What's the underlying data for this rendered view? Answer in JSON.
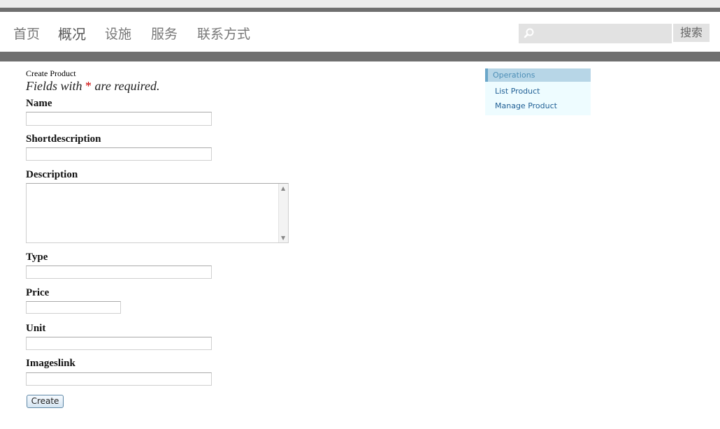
{
  "nav": {
    "items": [
      {
        "label": "首页"
      },
      {
        "label": "概况"
      },
      {
        "label": "设施"
      },
      {
        "label": "服务"
      },
      {
        "label": "联系方式"
      }
    ],
    "search_button": "搜索",
    "search_placeholder": ""
  },
  "page": {
    "breadcrumb": "Create Product",
    "required_note_before": "Fields with ",
    "required_star": "*",
    "required_note_after": " are required."
  },
  "form": {
    "fields": [
      {
        "label": "Name"
      },
      {
        "label": "Shortdescription"
      },
      {
        "label": "Description"
      },
      {
        "label": "Type"
      },
      {
        "label": "Price"
      },
      {
        "label": "Unit"
      },
      {
        "label": "Imageslink"
      }
    ],
    "submit_label": "Create"
  },
  "operations": {
    "title": "Operations",
    "items": [
      {
        "label": "List Product"
      },
      {
        "label": "Manage Product"
      }
    ]
  }
}
